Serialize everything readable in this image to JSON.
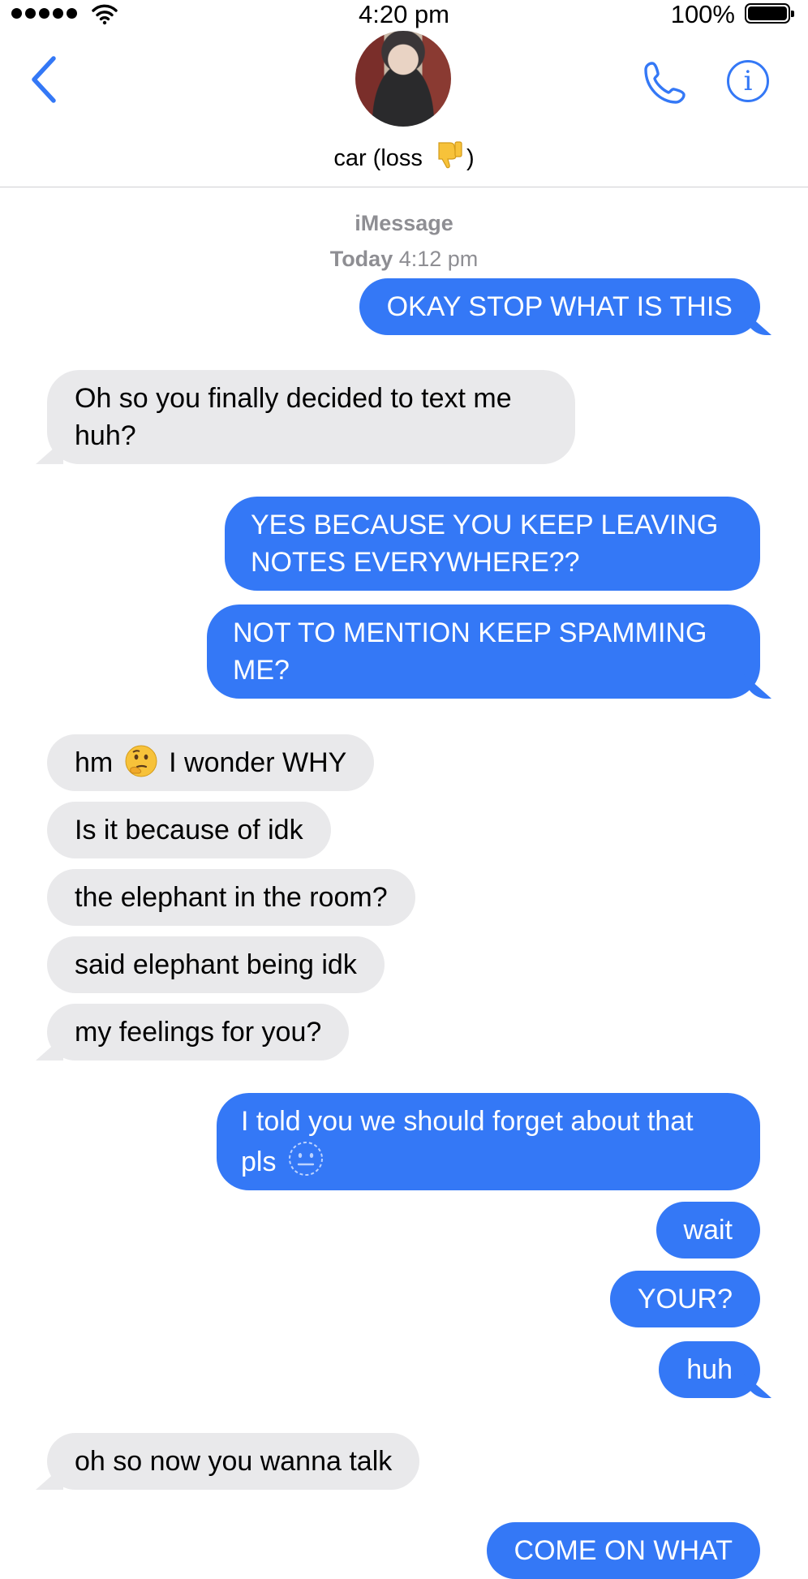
{
  "status_bar": {
    "time": "4:20 pm",
    "battery": "100%",
    "signal_icon": "signal-dots-icon",
    "wifi_icon": "wifi-icon",
    "battery_icon": "battery-icon"
  },
  "header": {
    "back_icon": "chevron-left-icon",
    "contact_name": "car (loss ",
    "contact_name_end": ")",
    "name_emoji": "thumbs-down-emoji",
    "call_icon": "phone-icon",
    "info_icon": "info-icon",
    "info_glyph": "i",
    "accent": "#3478f6"
  },
  "conversation": {
    "service_label": "iMessage",
    "timestamp_day": "Today",
    "timestamp_time": " 4:12 pm",
    "colors": {
      "outgoing": "#3478f6",
      "incoming": "#e9e9eb"
    },
    "messages": [
      {
        "from": "me",
        "text": "OKAY STOP WHAT IS THIS"
      },
      {
        "from": "them",
        "text": "Oh so you finally decided to text me huh?"
      },
      {
        "from": "me",
        "text": "YES BECAUSE YOU KEEP LEAVING NOTES EVERYWHERE??"
      },
      {
        "from": "me",
        "text": "NOT TO MENTION KEEP SPAMMING ME?"
      },
      {
        "from": "them",
        "text_before": "hm ",
        "emoji": "thinking-face-emoji",
        "text_after": " I wonder WHY"
      },
      {
        "from": "them",
        "text": "Is it because of idk"
      },
      {
        "from": "them",
        "text": "the elephant in the room?"
      },
      {
        "from": "them",
        "text": "said elephant being idk"
      },
      {
        "from": "them",
        "text": "my feelings for you?"
      },
      {
        "from": "me",
        "text_before": "I told you we should forget about that pls ",
        "emoji": "neutral-face-emoji"
      },
      {
        "from": "me",
        "text": "wait"
      },
      {
        "from": "me",
        "text": "YOUR?"
      },
      {
        "from": "me",
        "text": "huh"
      },
      {
        "from": "them",
        "text": "oh so now you wanna talk"
      },
      {
        "from": "me",
        "text": "COME ON WHAT"
      }
    ]
  }
}
